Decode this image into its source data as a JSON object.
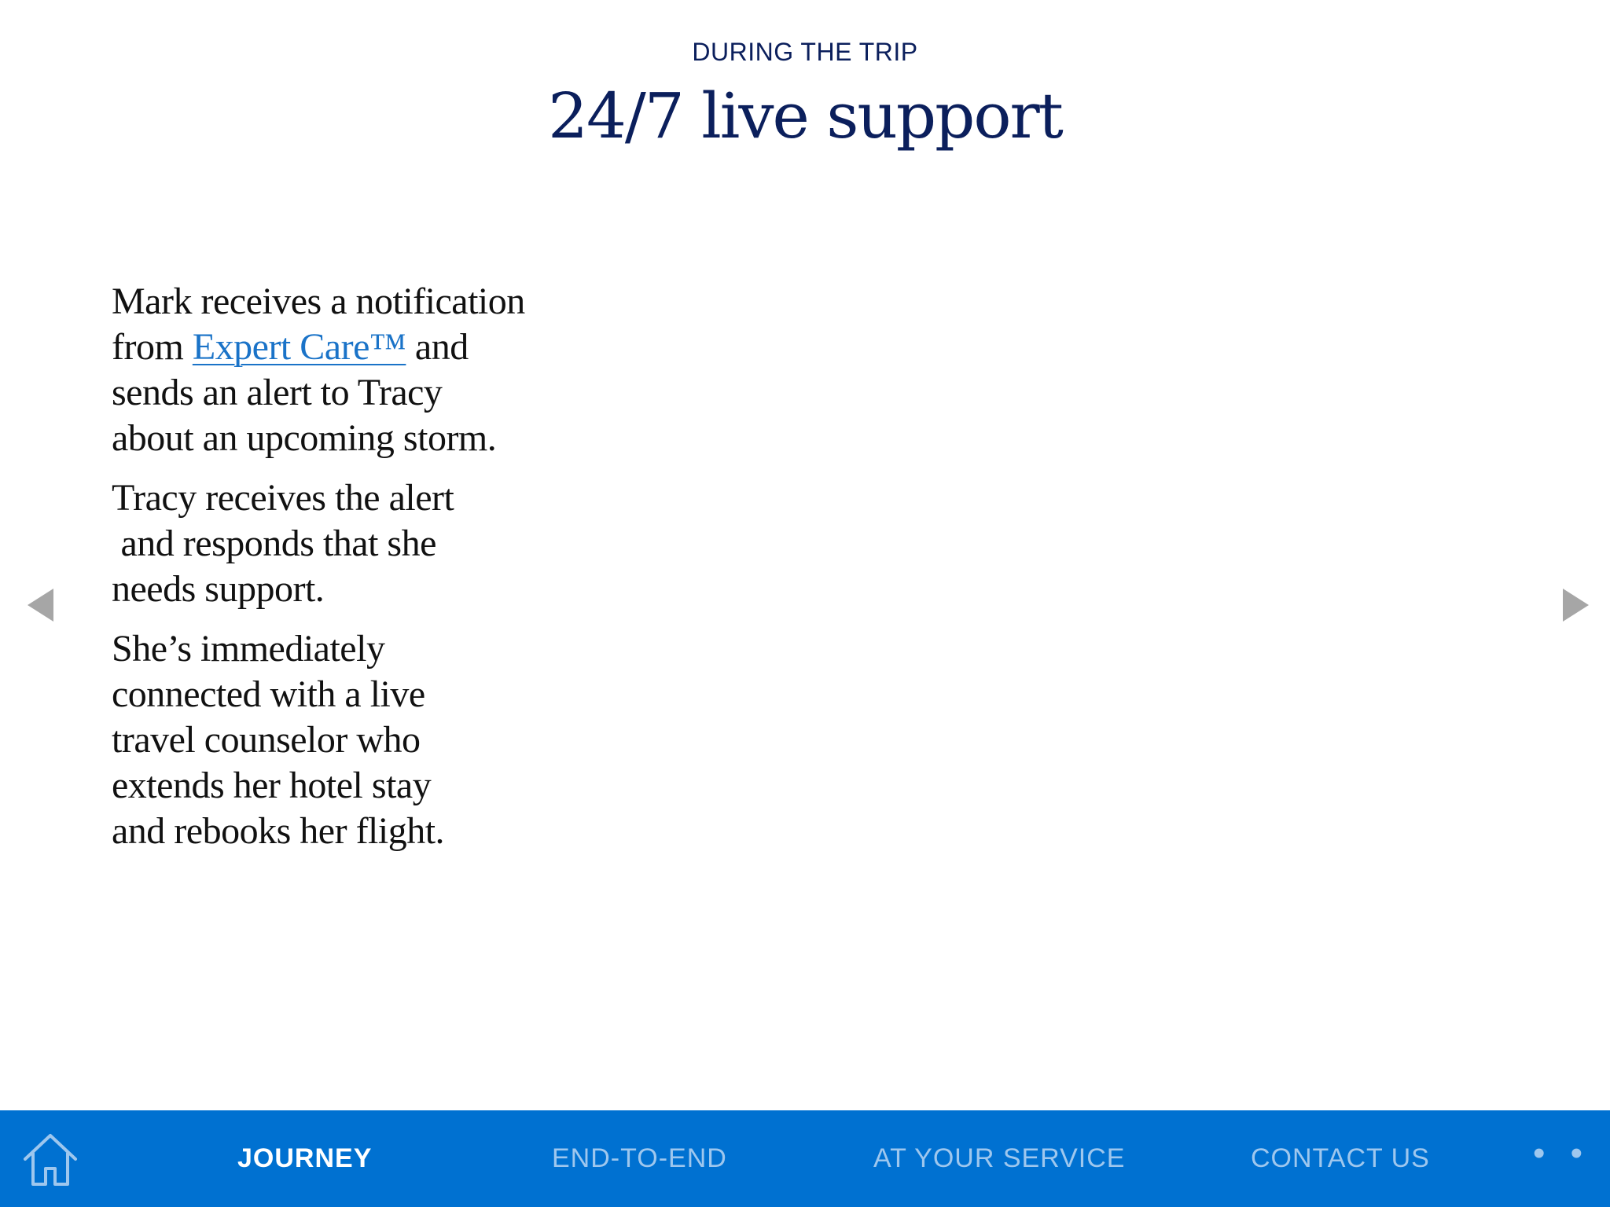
{
  "header": {
    "eyebrow": "DURING THE TRIP",
    "title": "24/7 live support"
  },
  "content": {
    "p1_line1": "Mark receives a notification",
    "p1_line2_pre": "from ",
    "p1_link": "Expert Care™",
    "p1_line2_post": " and",
    "p1_line3": "sends an alert to Tracy",
    "p1_line4": "about an upcoming storm.",
    "p2_line1": "Tracy receives the alert",
    "p2_line2": " and responds that she",
    "p2_line3": "needs support.",
    "p3_line1": "She’s immediately",
    "p3_line2": "connected with a live",
    "p3_line3": "travel counselor who",
    "p3_line4": "extends her hotel stay",
    "p3_line5": "and rebooks her flight."
  },
  "nav": {
    "tabs": [
      {
        "label": "JOURNEY",
        "active": true
      },
      {
        "label": "END-TO-END",
        "active": false
      },
      {
        "label": "AT YOUR SERVICE",
        "active": false
      },
      {
        "label": "CONTACT US",
        "active": false
      }
    ],
    "more_label": "• • •"
  },
  "icons": {
    "home": "home-icon",
    "prev": "triangle-left-icon",
    "next": "triangle-right-icon"
  },
  "colors": {
    "title": "#0b1f5c",
    "link": "#1a73c8",
    "bar": "#0071d1",
    "tab_inactive": "#9ec7ee",
    "tab_active": "#ffffff",
    "arrow": "#a6a6a6"
  }
}
